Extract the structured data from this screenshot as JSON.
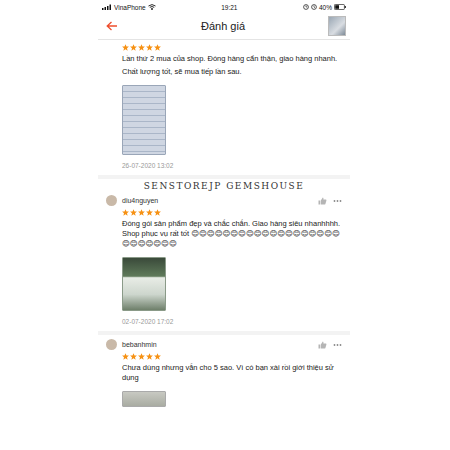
{
  "status_bar": {
    "carrier": "VinaPhone",
    "time": "19:21",
    "battery": "40%"
  },
  "header": {
    "title": "Đánh giá"
  },
  "watermark": "SENSTOREJP GEMSHOUSE",
  "reviews": [
    {
      "username": "",
      "stars": 5,
      "paragraphs": [
        "Lần thứ 2 mua của shop. Đóng hàng cẩn thận, giao hàng nhanh.",
        "Chất lượng tốt, sẽ mua tiếp lần sau."
      ],
      "date": "26-07-2020 13:02"
    },
    {
      "username": "diu4nguyen",
      "stars": 5,
      "paragraphs": [
        "Đóng gói sản phẩm đẹp và chắc chắn. Giao hàng siêu nhanhhhh. Shop phục vụ rất tốt 😊😊😊😊😊😊😊😊😊😊😊😊😊😊😊😊😊😊😊😊😊😊😊😊😊😊"
      ],
      "date": "02-07-2020 17:02"
    },
    {
      "username": "bebanhmin",
      "stars": 5,
      "paragraphs": [
        "Chưa dùng nhưng vẫn cho 5 sao. Vì có bạn xài rồi giới thiệu sử dụng"
      ],
      "date": ""
    }
  ]
}
